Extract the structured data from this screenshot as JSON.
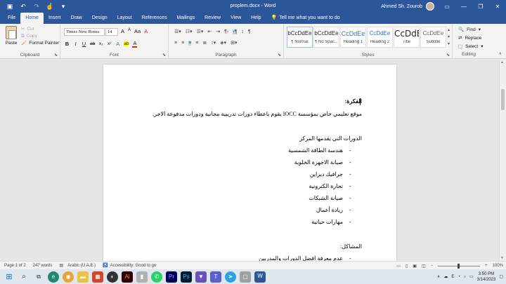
{
  "window": {
    "title": "proplem.docx - Word",
    "user_name": "Ahmed Sh. Zourob",
    "qat_icons": [
      "save-icon",
      "undo-icon",
      "redo-icon",
      "touch-mode-icon",
      "customize-icon"
    ],
    "controls": [
      "minimize-icon",
      "restore-icon",
      "close-icon"
    ]
  },
  "tabs": [
    "File",
    "Home",
    "Insert",
    "Draw",
    "Design",
    "Layout",
    "References",
    "Mailings",
    "Review",
    "View",
    "Help"
  ],
  "active_tab": "Home",
  "tell_me": "Tell me what you want to do",
  "ribbon": {
    "clipboard": {
      "label": "Clipboard",
      "paste": "Paste",
      "cut": "Cut",
      "copy": "Copy",
      "format_painter": "Format Painter"
    },
    "font": {
      "label": "Font",
      "family": "Times New Roma",
      "size": "14",
      "bold": "B",
      "italic": "I",
      "underline": "U",
      "strike": "ab",
      "subscript": "x₂",
      "superscript": "x²",
      "grow": "A",
      "shrink": "A",
      "case": "Aa",
      "clear": "A",
      "effects": "A",
      "highlight": "ab",
      "color": "A"
    },
    "paragraph": {
      "label": "Paragraph",
      "marks": "¶"
    },
    "styles": {
      "label": "Styles",
      "items": [
        {
          "preview": "bCcDdEe",
          "name": "¶ Normal"
        },
        {
          "preview": "bCcDdEe",
          "name": "¶ No Spac..."
        },
        {
          "preview": "CcDdEe",
          "name": "Heading 1"
        },
        {
          "preview": "CcDdEe",
          "name": "Heading 2"
        },
        {
          "preview": "CcDdEe",
          "name": "Title"
        },
        {
          "preview": "CcDdEe",
          "name": "Subtitle"
        }
      ]
    },
    "editing": {
      "label": "Editing",
      "find": "Find",
      "replace": "Replace",
      "select": "Select"
    }
  },
  "document": {
    "heading1": "الفكرة:",
    "line1": "موقع تعليمي خاص بمؤسسة  IOCC يقوم باعطاء دورات تدريبية مجانية ودورات مدفوعة الاجر.",
    "heading2": "الدورات التي يقدمها المركز",
    "courses": [
      "هندسة الطاقة الشمسية",
      "صيانة الاجهزة الخلوية",
      "جرافيك ديزاين",
      "تجارة الكترونية",
      "صيانة الشبكات",
      "ريادة أعمال",
      "مهارات حياتية"
    ],
    "heading3": "المشاكل:",
    "problem1": "عدم معرفة افضل الدورات والمدربين"
  },
  "status": {
    "page": "Page 1 of 2",
    "words": "247 words",
    "language": "Arabic (U.A.E.)",
    "accessibility": "Accessibility: Good to go",
    "zoom": "100%",
    "zoom_minus": "−",
    "zoom_plus": "+"
  },
  "taskbar": {
    "time": "3:50 PM",
    "date": "3/14/2023",
    "lang": "E"
  },
  "colors": {
    "accent": "#2b579a",
    "ribbon": "#f3f3f3",
    "workspace": "#e6e6e6"
  }
}
